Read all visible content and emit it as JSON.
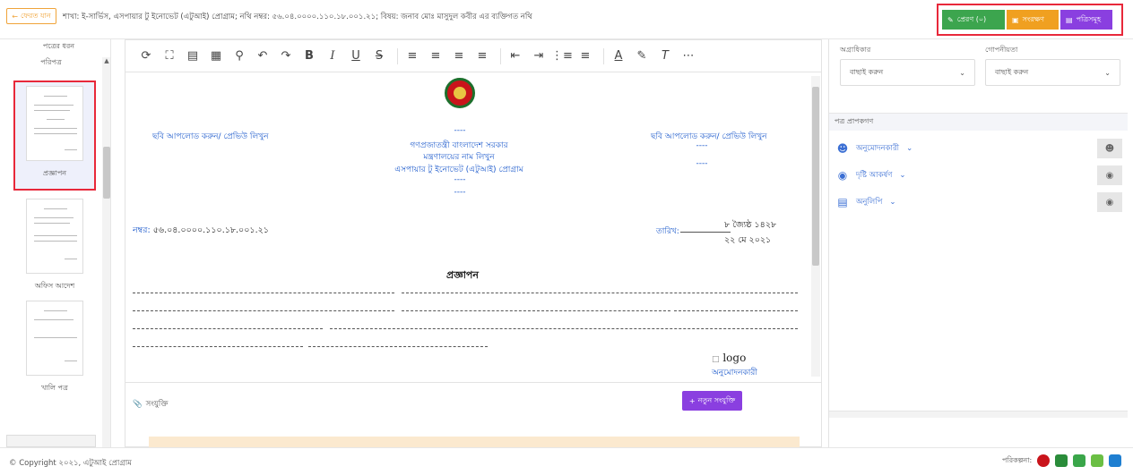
{
  "topbar": {
    "back_label": "ফেরত যান",
    "breadcrumb": "শাখা: ই-সার্ভিস, এসপায়ার টু ইনোভেট (এটুআই) প্রোগ্রাম; নথি নম্বর: ৫৬.০৪.০০০০.১১০.১৮.০০১.২১; বিষয়: জনাব মোঃ মাসুদুল কবীর এর ব্যক্তিগত নথি",
    "send_label": "প্রেরণ (০)",
    "save_label": "সংরক্ষণ",
    "all_label": "পত্রিসমূহ"
  },
  "leftpanel": {
    "title": "পত্রের ধরন",
    "subtitle": "পরিপত্র",
    "items": [
      {
        "label": "প্রজ্ঞাপন"
      },
      {
        "label": "অফিস আদেশ"
      },
      {
        "label": "খালি পত্র"
      }
    ]
  },
  "document": {
    "left_upload": "ছবি আপলোড করুন/ প্রেভিউ লিখুন",
    "right_upload": "ছবি আপলোড করুন/ প্রেভিউ লিখুন",
    "dash_a": "----",
    "dash_b": "----",
    "dash_c": "----",
    "dash_d": "----",
    "gov_line": "গণপ্রজাতন্ত্রী বাংলাদেশ সরকার",
    "ministry_line": "মন্ত্রণালয়ের নাম লিখুন",
    "program_line": "এসপায়ার টু ইনোভেট (এটুআই) প্রোগ্রাম",
    "number_label": "নম্বর:",
    "number_value": "৫৬.০৪.০০০০.১১০.১৮.০০১.২১",
    "date_label": "তারিখ:",
    "date_bn": "৮ জ্যৈষ্ঠ ১৪২৮",
    "date_en": "২২ মে ২০২১",
    "doc_title": "প্রজ্ঞাপন",
    "logo_alt": "logo",
    "approver_label": "অনুমোদনকারী"
  },
  "attachments": {
    "label": "সংযুক্তি",
    "new_label": "নতুন সংযুক্তি"
  },
  "rightpanel": {
    "priority_label": "অগ্রাধিকার",
    "confidentiality_label": "গোপনীয়তা",
    "priority_value": "বাছাই করুন",
    "confidentiality_value": "বাছাই করুন",
    "section_title": "পত্র প্রাপকগণ",
    "rows": [
      {
        "label": "অনুমোদনকারী"
      },
      {
        "label": "দৃষ্টি আকর্ষণ"
      },
      {
        "label": "অনুলিপি"
      }
    ]
  },
  "footer": {
    "copyright": "© Copyright ২০২১, এটুআই প্রোগ্রাম",
    "partners_label": "পরিকল্পনা:"
  }
}
